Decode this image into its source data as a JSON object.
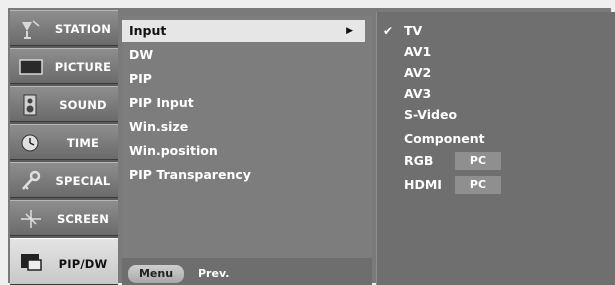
{
  "categories": [
    {
      "label": "STATION",
      "icon": "antenna-icon"
    },
    {
      "label": "PICTURE",
      "icon": "tv-screen-icon"
    },
    {
      "label": "SOUND",
      "icon": "speaker-icon"
    },
    {
      "label": "TIME",
      "icon": "clock-icon"
    },
    {
      "label": "SPECIAL",
      "icon": "key-icon"
    },
    {
      "label": "SCREEN",
      "icon": "crosshair-icon"
    },
    {
      "label": "PIP/DW",
      "icon": "pip-icon",
      "active": true
    }
  ],
  "submenu": {
    "items": [
      {
        "label": "Input",
        "selected": true,
        "arrow": "▶"
      },
      {
        "label": "DW"
      },
      {
        "label": "PIP"
      },
      {
        "label": "PIP Input"
      },
      {
        "label": "Win.size"
      },
      {
        "label": "Win.position"
      },
      {
        "label": "PIP Transparency"
      }
    ]
  },
  "footer": {
    "menu_label": "Menu",
    "prev_label": "Prev."
  },
  "options": {
    "check_glyph": "✔",
    "items": [
      {
        "label": "TV",
        "checked": true
      },
      {
        "label": "AV1"
      },
      {
        "label": "AV2"
      },
      {
        "label": "AV3"
      },
      {
        "label": "S-Video"
      },
      {
        "label": "Component"
      },
      {
        "label": "RGB",
        "chip": "PC"
      },
      {
        "label": "HDMI",
        "chip": "PC"
      }
    ]
  }
}
